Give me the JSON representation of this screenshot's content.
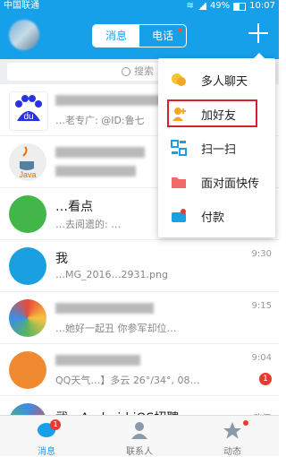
{
  "status_bar": {
    "carrier": "中国联通",
    "battery": "49%",
    "time": "10:07"
  },
  "header": {
    "tabs": [
      {
        "label": "消息",
        "active": true
      },
      {
        "label": "电话",
        "active": false
      }
    ]
  },
  "search": {
    "placeholder": "搜索"
  },
  "conversations": [
    {
      "icon": "baidu-logo-icon",
      "name_visible": "",
      "snippet": "…老专广: @ID:鲁七",
      "time": ""
    },
    {
      "icon": "java-logo-icon",
      "name_visible": "",
      "snippet": "",
      "time": ""
    },
    {
      "icon": "green-circle-icon",
      "name_visible": "…看点",
      "snippet": "…去阅遗的: …",
      "time": ""
    },
    {
      "icon": "blue-square-avatar",
      "name_visible": "我",
      "snippet": "…MG_2016…2931.png",
      "time": "9:30"
    },
    {
      "icon": "colorful-circle-avatar",
      "name_visible": "",
      "snippet": "…她好一起丑 你参军却位…",
      "time": "9:15"
    },
    {
      "icon": "orange-avatar",
      "name_visible": "",
      "snippet": "QQ天气…】多云 26°/34°, 08…",
      "time": "9:04",
      "unread": "1"
    },
    {
      "icon": "colorful-avatar",
      "name_visible": "武…Android iOS招聘",
      "snippet": "",
      "time": "昨天"
    }
  ],
  "menu": {
    "items": [
      {
        "label": "多人聊天",
        "icon": "group-chat-icon"
      },
      {
        "label": "加好友",
        "icon": "add-friend-icon",
        "highlighted": true
      },
      {
        "label": "扫一扫",
        "icon": "scan-icon"
      },
      {
        "label": "面对面快传",
        "icon": "folder-transfer-icon"
      },
      {
        "label": "付款",
        "icon": "payment-icon"
      }
    ]
  },
  "tabbar": {
    "items": [
      {
        "label": "消息",
        "icon": "message-icon",
        "badge": "1",
        "active": true
      },
      {
        "label": "联系人",
        "icon": "contacts-icon"
      },
      {
        "label": "动态",
        "icon": "star-icon",
        "dot": true
      }
    ]
  },
  "colors": {
    "brand": "#16a0ea",
    "highlight": "#d8202a",
    "badge": "#e63c30"
  }
}
